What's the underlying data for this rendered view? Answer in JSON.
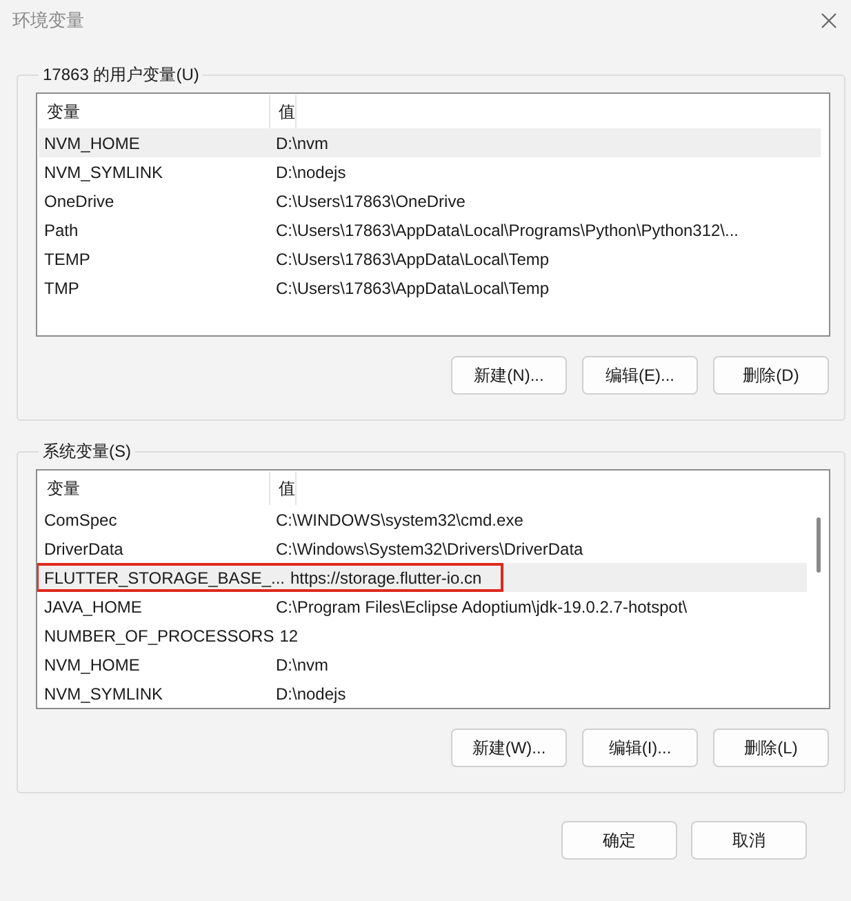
{
  "window": {
    "title": "环境变量"
  },
  "user_variables": {
    "title": "17863 的用户变量(U)",
    "columns": [
      "变量",
      "值"
    ],
    "rows": [
      {
        "cells": [
          "NVM_HOME",
          "D:\\nvm"
        ],
        "selected": true,
        "annotated": false
      },
      {
        "cells": [
          "NVM_SYMLINK",
          "D:\\nodejs"
        ],
        "selected": false,
        "annotated": false
      },
      {
        "cells": [
          "OneDrive",
          "C:\\Users\\17863\\OneDrive"
        ],
        "selected": false,
        "annotated": false
      },
      {
        "cells": [
          "Path",
          "C:\\Users\\17863\\AppData\\Local\\Programs\\Python\\Python312\\..."
        ],
        "selected": false,
        "annotated": false
      },
      {
        "cells": [
          "TEMP",
          "C:\\Users\\17863\\AppData\\Local\\Temp"
        ],
        "selected": false,
        "annotated": false
      },
      {
        "cells": [
          "TMP",
          "C:\\Users\\17863\\AppData\\Local\\Temp"
        ],
        "selected": false,
        "annotated": false
      }
    ],
    "buttons": [
      "新建(N)...",
      "编辑(E)...",
      "删除(D)"
    ]
  },
  "system_variables": {
    "title": "系统变量(S)",
    "columns": [
      "变量",
      "值"
    ],
    "rows": [
      {
        "cells": [
          "ComSpec",
          "C:\\WINDOWS\\system32\\cmd.exe"
        ],
        "selected": false,
        "annotated": false
      },
      {
        "cells": [
          "DriverData",
          "C:\\Windows\\System32\\Drivers\\DriverData"
        ],
        "selected": false,
        "annotated": false
      },
      {
        "cells": [
          "FLUTTER_STORAGE_BASE_...",
          "https://storage.flutter-io.cn"
        ],
        "selected": true,
        "annotated": true
      },
      {
        "cells": [
          "JAVA_HOME",
          "C:\\Program Files\\Eclipse Adoptium\\jdk-19.0.2.7-hotspot\\"
        ],
        "selected": false,
        "annotated": false
      },
      {
        "cells": [
          "NUMBER_OF_PROCESSORS",
          "12"
        ],
        "selected": false,
        "annotated": false
      },
      {
        "cells": [
          "NVM_HOME",
          "D:\\nvm"
        ],
        "selected": false,
        "annotated": false
      },
      {
        "cells": [
          "NVM_SYMLINK",
          "D:\\nodejs"
        ],
        "selected": false,
        "annotated": false
      }
    ],
    "buttons": [
      "新建(W)...",
      "编辑(I)...",
      "删除(L)"
    ]
  },
  "dialog_buttons": [
    "确定",
    "取消"
  ]
}
